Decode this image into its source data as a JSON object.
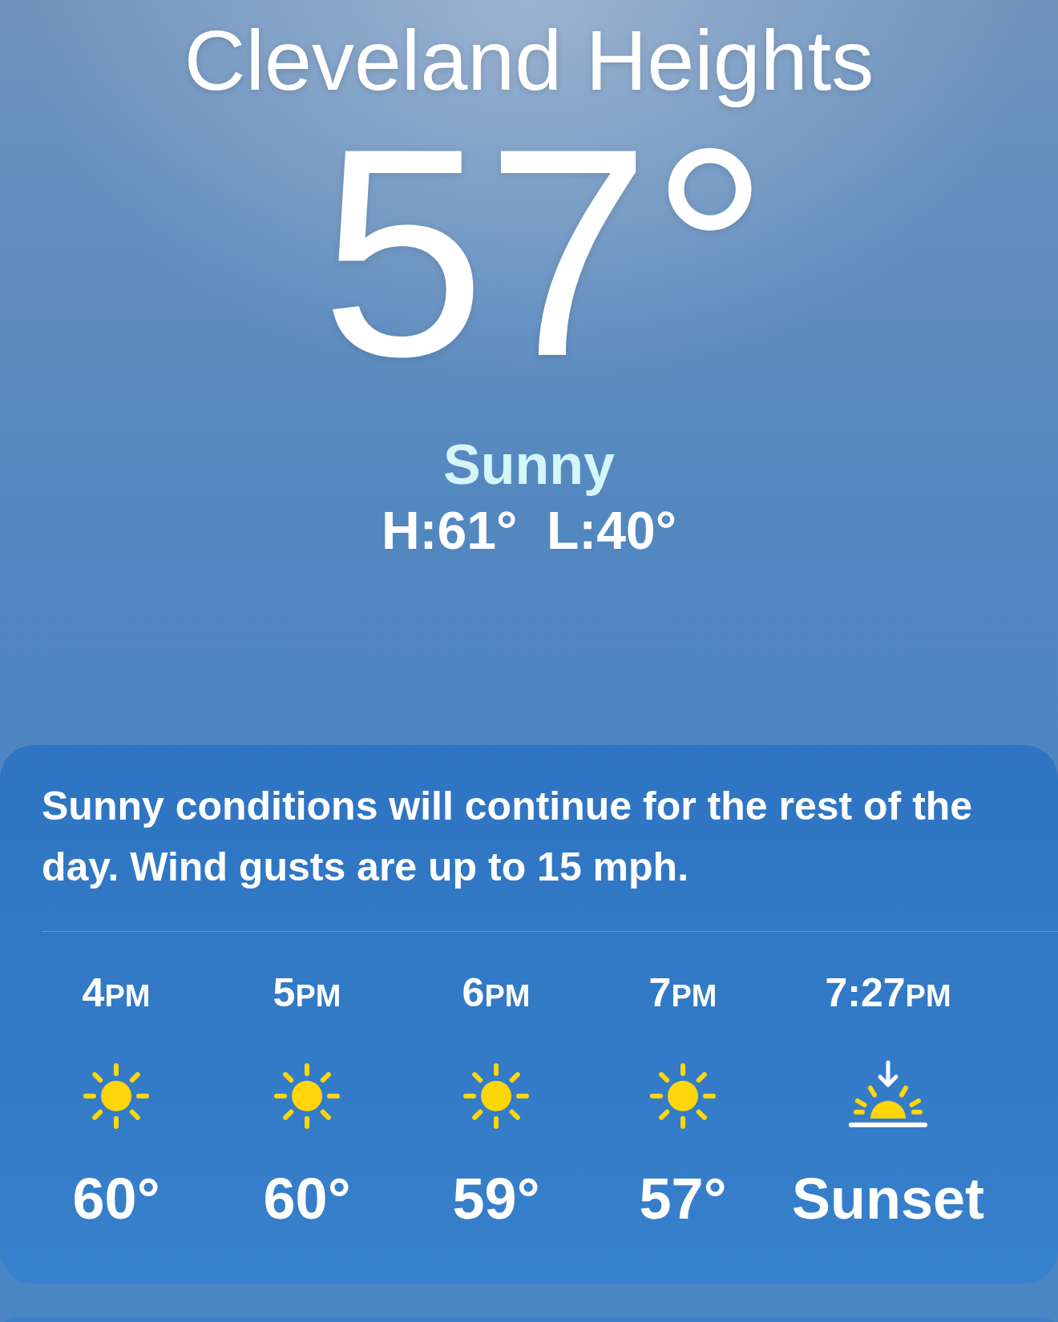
{
  "location": {
    "city": "Cleveland Heights",
    "temperature": "57°",
    "condition": "Sunny",
    "high_low": "H:61°  L:40°"
  },
  "forecast_card": {
    "summary": "Sunny conditions will continue for the rest of the day. Wind gusts are up to 15 mph.",
    "hours": [
      {
        "time": "4",
        "period": "PM",
        "kind": "sun",
        "value": "60°"
      },
      {
        "time": "5",
        "period": "PM",
        "kind": "sun",
        "value": "60°"
      },
      {
        "time": "6",
        "period": "PM",
        "kind": "sun",
        "value": "59°"
      },
      {
        "time": "7",
        "period": "PM",
        "kind": "sun",
        "value": "57°"
      },
      {
        "time": "7:27",
        "period": "PM",
        "kind": "sunset",
        "value": "Sunset"
      }
    ]
  }
}
